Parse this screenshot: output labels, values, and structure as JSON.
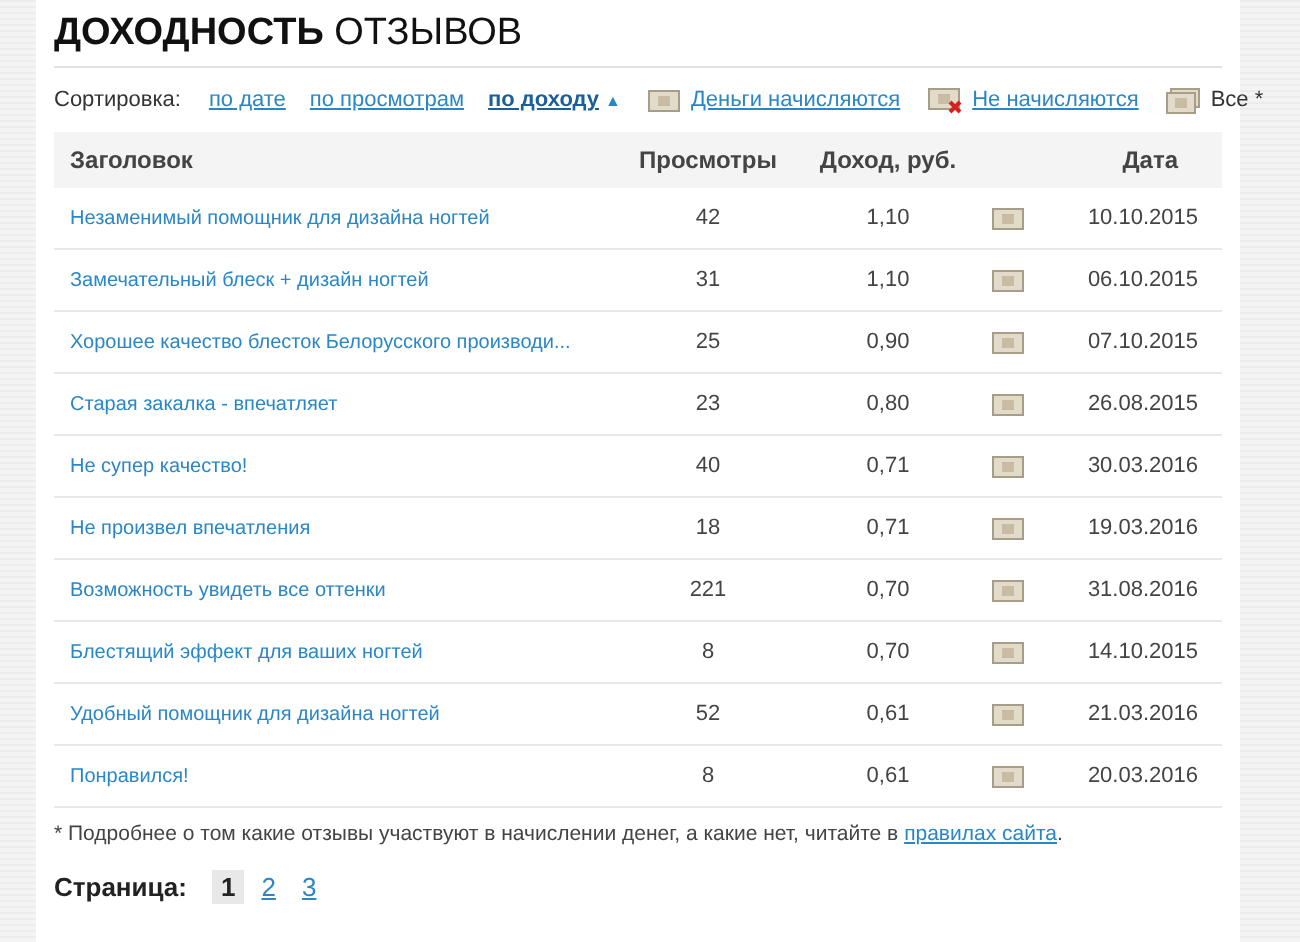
{
  "title": {
    "bold": "ДОХОДНОСТЬ",
    "rest": "ОТЗЫВОВ"
  },
  "sort": {
    "label": "Сортировка:",
    "arrow": "▲",
    "options": [
      {
        "label": "по дате",
        "selected": false
      },
      {
        "label": "по просмотрам",
        "selected": false
      },
      {
        "label": "по доходу",
        "selected": true
      }
    ]
  },
  "filters": [
    {
      "kind": "money",
      "label": "Деньги начисляются",
      "selected": false
    },
    {
      "kind": "money-crossed",
      "label": "Не начисляются",
      "selected": false
    },
    {
      "kind": "money-stack",
      "label": "Все *",
      "selected": true
    }
  ],
  "table": {
    "columns": [
      "Заголовок",
      "Просмотры",
      "Доход, руб.",
      "Дата"
    ],
    "rows": [
      {
        "title": "Незаменимый помощник для дизайна ногтей",
        "views": "42",
        "income": "1,10",
        "date": "10.10.2015"
      },
      {
        "title": "Замечательный блеск + дизайн ногтей",
        "views": "31",
        "income": "1,10",
        "date": "06.10.2015"
      },
      {
        "title": "Хорошее качество блесток Белорусского производи...",
        "views": "25",
        "income": "0,90",
        "date": "07.10.2015"
      },
      {
        "title": "Старая закалка - впечатляет",
        "views": "23",
        "income": "0,80",
        "date": "26.08.2015"
      },
      {
        "title": "Не супер качество!",
        "views": "40",
        "income": "0,71",
        "date": "30.03.2016"
      },
      {
        "title": "Не произвел впечатления",
        "views": "18",
        "income": "0,71",
        "date": "19.03.2016"
      },
      {
        "title": "Возможность увидеть все оттенки",
        "views": "221",
        "income": "0,70",
        "date": "31.08.2016"
      },
      {
        "title": "Блестящий эффект для ваших ногтей",
        "views": "8",
        "income": "0,70",
        "date": "14.10.2015"
      },
      {
        "title": "Удобный помощник для дизайна ногтей",
        "views": "52",
        "income": "0,61",
        "date": "21.03.2016"
      },
      {
        "title": "Понравился!",
        "views": "8",
        "income": "0,61",
        "date": "20.03.2016"
      }
    ]
  },
  "footnote": {
    "text": "* Подробнее о том какие отзывы участвуют в начислении денег, а какие нет, читайте в",
    "link": "правилах сайта",
    "end": "."
  },
  "pagination": {
    "label": "Страница:",
    "pages": [
      {
        "label": "1",
        "selected": true
      },
      {
        "label": "2",
        "selected": false
      },
      {
        "label": "3",
        "selected": false
      }
    ]
  }
}
